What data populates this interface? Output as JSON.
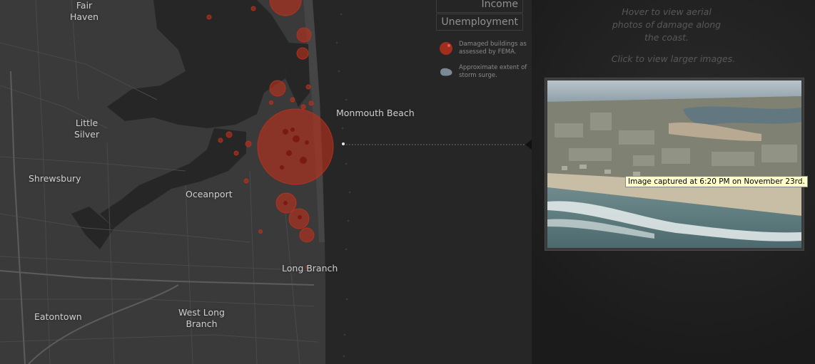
{
  "map": {
    "towns": [
      {
        "name": "Fair\nHaven",
        "key": "fair-haven"
      },
      {
        "name": "Little\nSilver",
        "key": "little-silver"
      },
      {
        "name": "Shrewsbury",
        "key": "shrewsbury"
      },
      {
        "name": "Oceanport",
        "key": "oceanport"
      },
      {
        "name": "Monmouth Beach",
        "key": "monmouth-beach"
      },
      {
        "name": "Long Branch",
        "key": "long-branch"
      },
      {
        "name": "Eatontown",
        "key": "eatontown"
      },
      {
        "name": "West Long\nBranch",
        "key": "west-long-branch"
      }
    ],
    "colors": {
      "land": "#3a3a3a",
      "water": "#262626",
      "damage": "#c0301c",
      "storm_surge": "#7d8895"
    }
  },
  "toggle": {
    "income_label": "Income",
    "unemployment_label": "Unemployment"
  },
  "legend": {
    "damaged_label": "Damaged buildings as assessed by FEMA.",
    "surge_label": "Approximate extent of storm surge."
  },
  "sidebar": {
    "hint_hover": "Hover to view aerial photos of damage along the coast.",
    "hint_click": "Click to view larger images."
  },
  "photo": {
    "tooltip": "Image captured at 6:20 PM on November 23rd."
  }
}
